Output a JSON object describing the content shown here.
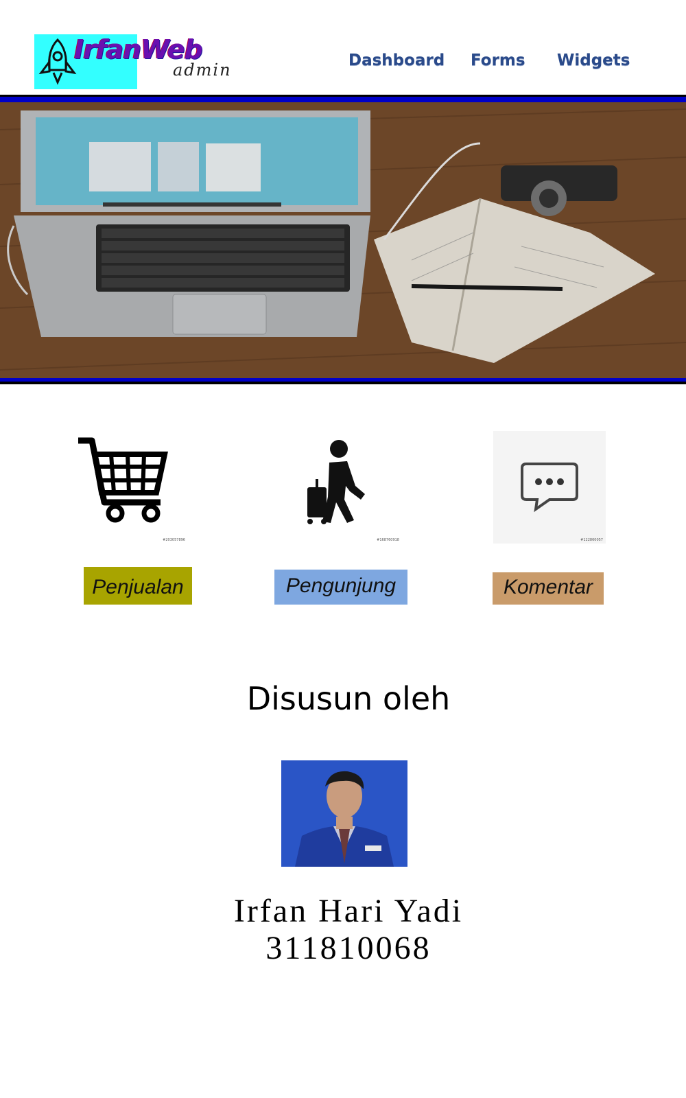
{
  "brand": {
    "title": "IrfanWeb",
    "subtitle": "admin",
    "logo_bg": "#33ffff"
  },
  "nav": {
    "items": [
      {
        "label": "Dashboard"
      },
      {
        "label": "Forms"
      },
      {
        "label": "Widgets"
      }
    ],
    "color": "#2a4a8a"
  },
  "hero": {
    "image": "laptop-notebook-camera-desk-photo",
    "frame_color": "#0000c8"
  },
  "features": [
    {
      "icon": "shopping-cart-icon",
      "label": "Penjualan",
      "color": "#a8a400",
      "stock_id": "#203057896"
    },
    {
      "icon": "traveler-with-luggage-icon",
      "label": "Pengunjung",
      "color": "#7ea7e0",
      "stock_id": "#168760918"
    },
    {
      "icon": "chat-bubble-icon",
      "label": "Komentar",
      "color": "#c99b6a",
      "stock_id": "#122860057"
    }
  ],
  "author": {
    "heading": "Disusun oleh",
    "name": "Irfan Hari Yadi",
    "id": "311810068",
    "photo": "author-portrait-photo"
  }
}
